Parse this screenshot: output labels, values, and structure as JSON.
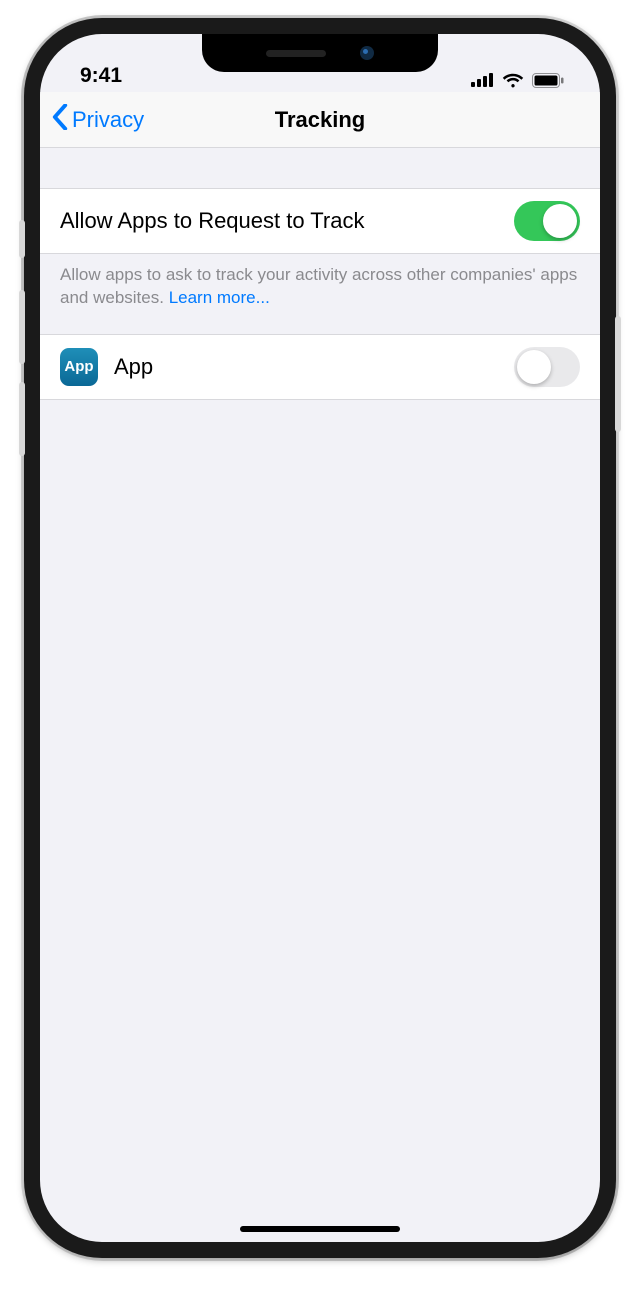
{
  "status": {
    "time": "9:41"
  },
  "nav": {
    "back_label": "Privacy",
    "title": "Tracking"
  },
  "setting": {
    "allow_label": "Allow Apps to Request to Track",
    "allow_on": true,
    "footer_text": "Allow apps to ask to track your activity across other companies' apps and websites. ",
    "learn_more": "Learn more..."
  },
  "apps": [
    {
      "icon_text": "App",
      "name": "App",
      "tracking_on": false
    }
  ]
}
